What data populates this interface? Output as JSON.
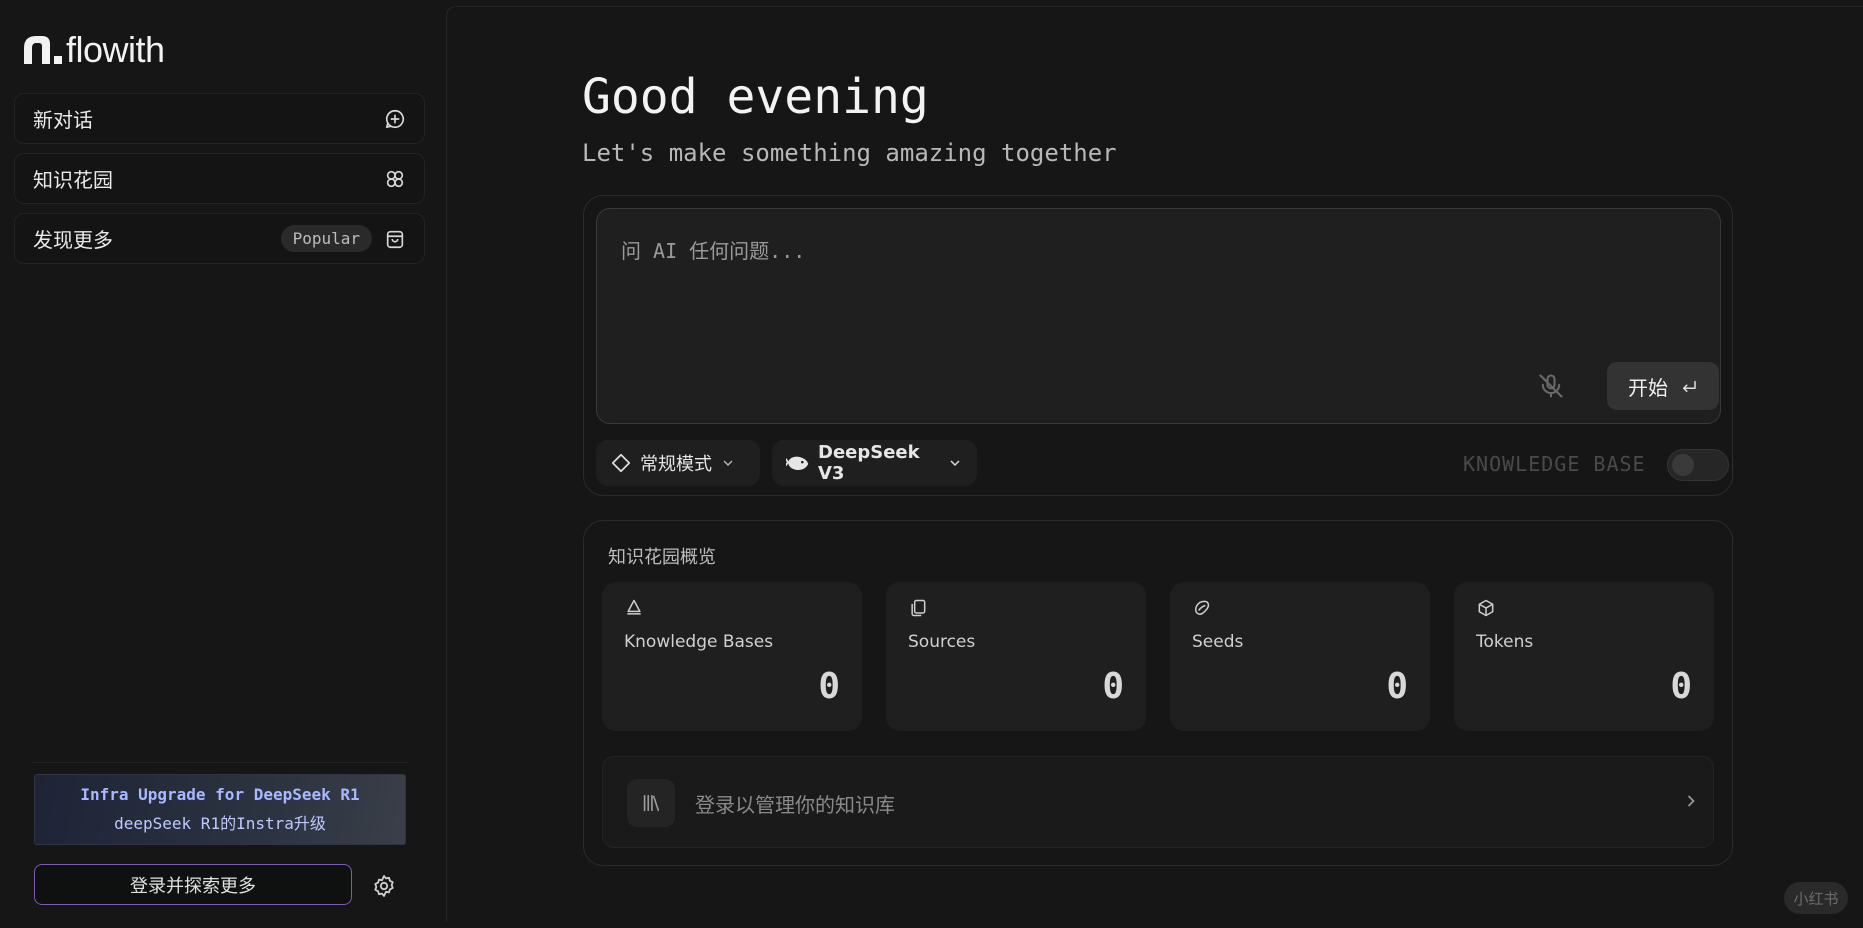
{
  "app": {
    "logo_text": "flowith"
  },
  "sidebar": {
    "items": [
      {
        "label": "新对话",
        "icon": "new-chat-icon"
      },
      {
        "label": "知识花园",
        "icon": "garden-icon"
      },
      {
        "label": "发现更多",
        "badge": "Popular",
        "icon": "bag-icon"
      }
    ],
    "promo": {
      "line1": "Infra Upgrade for DeepSeek R1",
      "line2": "deepSeek R1的Instra升级"
    },
    "login_label": "登录并探索更多",
    "settings_icon": "gear-icon"
  },
  "main": {
    "greeting": "Good evening",
    "subtitle": "Let's make something amazing together",
    "composer": {
      "placeholder": "问 AI 任何问题...",
      "start_label": "开始",
      "mode_label": "常规模式",
      "model_label": "DeepSeek V3",
      "knowledge_base_label": "KNOWLEDGE BASE",
      "knowledge_base_enabled": false
    },
    "overview": {
      "title": "知识花园概览",
      "stats": [
        {
          "label": "Knowledge Bases",
          "value": "0",
          "icon": "bell-icon"
        },
        {
          "label": "Sources",
          "value": "0",
          "icon": "copy-icon"
        },
        {
          "label": "Seeds",
          "value": "0",
          "icon": "seed-icon"
        },
        {
          "label": "Tokens",
          "value": "0",
          "icon": "cube-icon"
        }
      ],
      "manage_label": "登录以管理你的知识库"
    }
  },
  "watermark": "小红书",
  "colors": {
    "background": "#161616",
    "accent_border": "#7c5bb0",
    "promo_text": "#a9b8ff"
  }
}
